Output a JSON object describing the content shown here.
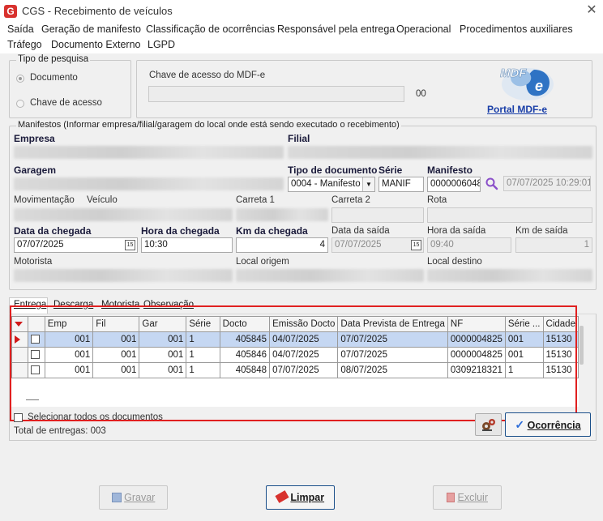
{
  "window": {
    "title": "CGS - Recebimento de veículos",
    "app_icon_letter": "G"
  },
  "menu": {
    "row1": [
      "Saída",
      "Geração de manifesto",
      "Classificação de ocorrências",
      "Responsável pela entrega",
      "Operacional",
      "Procedimentos auxiliares"
    ],
    "row2": [
      "Tráfego",
      "Documento Externo",
      "LGPD"
    ]
  },
  "search_type": {
    "title": "Tipo de pesquisa",
    "options": [
      "Documento",
      "Chave de acesso"
    ],
    "selected": "Documento"
  },
  "mdfe": {
    "key_label": "Chave de acesso do MDF-e",
    "key_value": "",
    "counter": "00",
    "logo_text": "MDF-e",
    "portal_link": "Portal MDF-e"
  },
  "manifest_section": {
    "title": "Manifestos (Informar empresa/filial/garagem do local onde está sendo executado o recebimento)",
    "labels": {
      "empresa": "Empresa",
      "filial": "Filial",
      "garagem": "Garagem",
      "tipo_doc": "Tipo de documento",
      "serie": "Série",
      "manifesto": "Manifesto",
      "movimentacao": "Movimentação",
      "veiculo": "Veículo",
      "carreta1": "Carreta 1",
      "carreta2": "Carreta 2",
      "rota": "Rota",
      "data_chegada": "Data da chegada",
      "hora_chegada": "Hora da chegada",
      "km_chegada": "Km da chegada",
      "data_saida": "Data da saída",
      "hora_saida": "Hora da saída",
      "km_saida": "Km de saída",
      "motorista": "Motorista",
      "local_origem": "Local origem",
      "local_destino": "Local destino"
    },
    "values": {
      "tipo_doc": "0004 - Manifesto",
      "serie": "MANIF",
      "manifesto": "0000006048",
      "manifesto_datetime": "07/07/2025 10:29:01",
      "data_chegada": "07/07/2025",
      "hora_chegada": "10:30",
      "km_chegada": "4",
      "data_saida": "07/07/2025",
      "hora_saida": "09:40",
      "km_saida": "1",
      "calendar_icon_text": "15"
    }
  },
  "tabs": [
    "Entrega",
    "Descarga",
    "Motorista",
    "Observação"
  ],
  "active_tab": "Entrega",
  "grid": {
    "columns": [
      "",
      "",
      "Emp",
      "Fil",
      "Gar",
      "Série",
      "Docto",
      "Emissão Docto",
      "Data Prevista de Entrega",
      "NF",
      "Série ...",
      "Cidade"
    ],
    "rows": [
      {
        "emp": "001",
        "fil": "001",
        "gar": "001",
        "serie": "1",
        "docto": "405845",
        "emissao": "04/07/2025",
        "prevista": "07/07/2025",
        "nf": "0000004825",
        "serie_nf": "001",
        "cidade": "15130",
        "selected": true
      },
      {
        "emp": "001",
        "fil": "001",
        "gar": "001",
        "serie": "1",
        "docto": "405846",
        "emissao": "04/07/2025",
        "prevista": "07/07/2025",
        "nf": "0000004825",
        "serie_nf": "001",
        "cidade": "15130",
        "selected": false
      },
      {
        "emp": "001",
        "fil": "001",
        "gar": "001",
        "serie": "1",
        "docto": "405848",
        "emissao": "07/07/2025",
        "prevista": "08/07/2025",
        "nf": "0309218321",
        "serie_nf": "1",
        "cidade": "15130",
        "selected": false
      }
    ]
  },
  "select_all_label": "Selecionar todos os documentos",
  "total_label": "Total de entregas: 003",
  "buttons": {
    "ocorrencia": "Ocorrência",
    "gravar": "Gravar",
    "limpar": "Limpar",
    "excluir": "Excluir"
  },
  "colors": {
    "highlight_rect": "#e02020",
    "selected_row": "#c5d7f2",
    "link": "#1a3fa8"
  }
}
